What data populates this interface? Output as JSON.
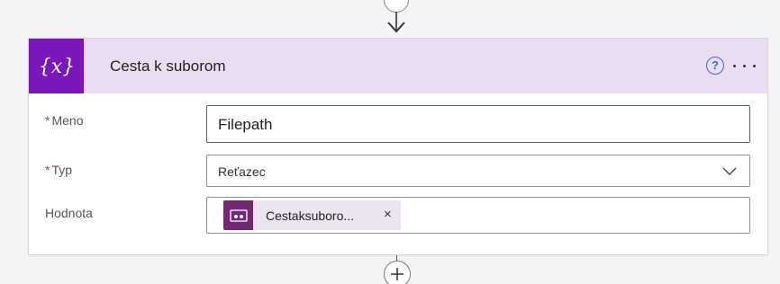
{
  "action": {
    "title": "Cesta k suborom",
    "icon": "variable-braces-icon",
    "header_color": "#e9dcf3",
    "icon_bg_color": "#7b16ba"
  },
  "help": {
    "glyph": "?"
  },
  "fields": {
    "name": {
      "required_mark": "*",
      "label": "Meno",
      "value": "Filepath"
    },
    "type": {
      "required_mark": "*",
      "label": "Typ",
      "value": "Reťazec"
    },
    "value": {
      "label": "Hodnota",
      "token_label": "Cestaksuboro...",
      "token_icon": "power-automate-token-icon",
      "token_color": "#742774",
      "token_remove": "×"
    }
  }
}
